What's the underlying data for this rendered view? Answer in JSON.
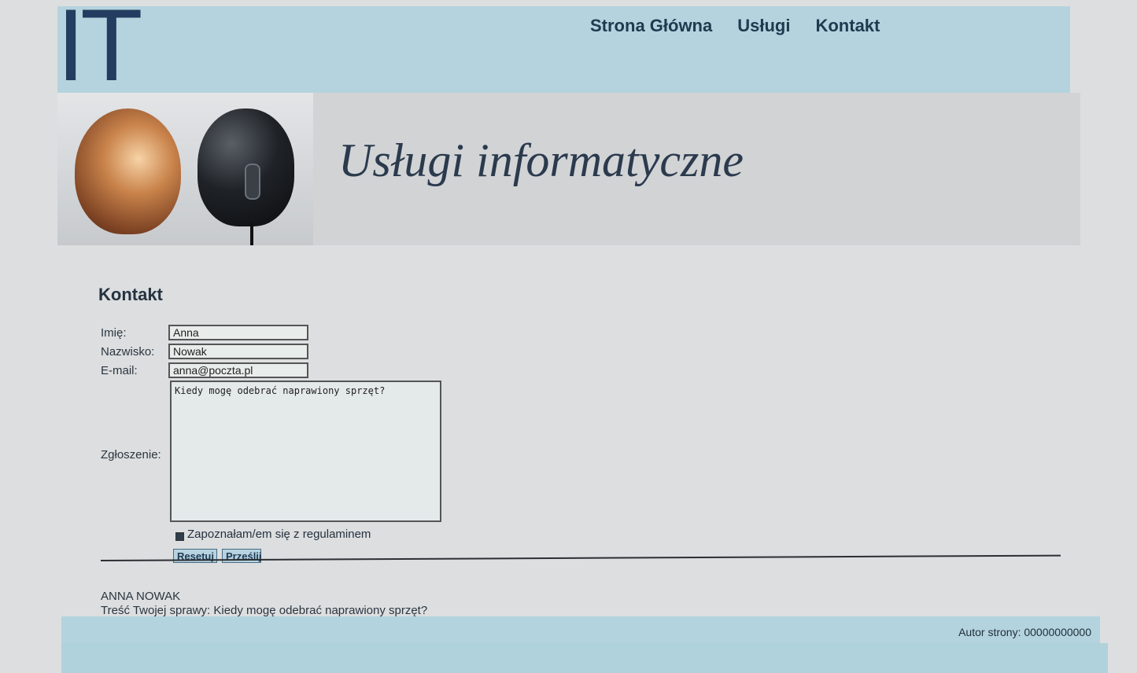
{
  "header": {
    "logo": "IT",
    "nav": [
      "Strona Główna",
      "Usługi",
      "Kontakt"
    ],
    "banner_title": "Usługi informatyczne"
  },
  "form": {
    "section_title": "Kontakt",
    "labels": {
      "first_name": "Imię:",
      "last_name": "Nazwisko:",
      "email": "E-mail:",
      "message": "Zgłoszenie:"
    },
    "values": {
      "first_name": "Anna",
      "last_name": "Nowak",
      "email": "anna@poczta.pl",
      "message": "Kiedy mogę odebrać naprawiony sprzęt?"
    },
    "checkbox_label": "Zapoznałam/em się z regulaminem",
    "buttons": {
      "reset": "Resetuj",
      "submit": "Prześlij"
    }
  },
  "result": {
    "name": "ANNA NOWAK",
    "text": "Treść Twojej sprawy: Kiedy mogę odebrać naprawiony sprzęt?"
  },
  "footer": {
    "author": "Autor strony: 00000000000"
  },
  "colors": {
    "header_bg": "#b5d3de",
    "banner_bg": "#d1d3d5",
    "page_bg": "#dcdedf",
    "footer_bg": "#b3d3de"
  }
}
